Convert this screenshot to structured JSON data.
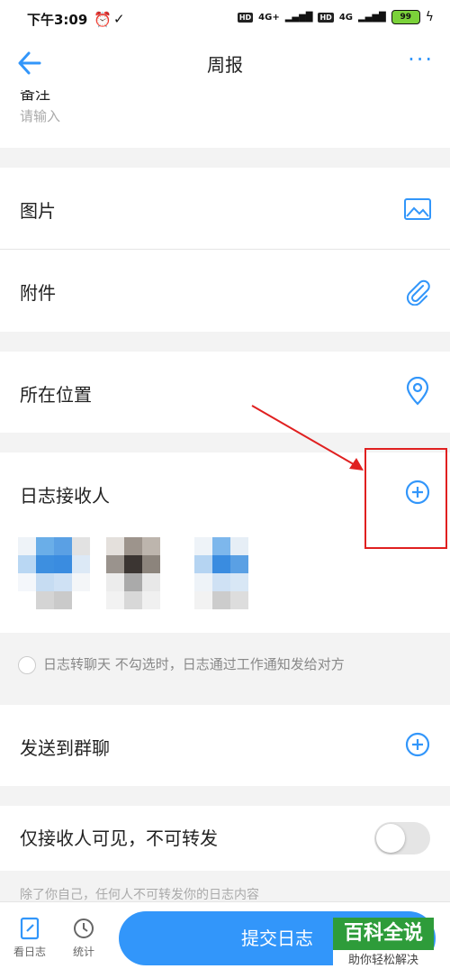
{
  "status": {
    "time": "下午3:09",
    "hd1": "HD",
    "net1": "4G+",
    "hd2": "HD",
    "net2": "4G",
    "battery": "99"
  },
  "nav": {
    "title": "周报",
    "more": "···"
  },
  "remark": {
    "label": "备注",
    "placeholder": "请输入"
  },
  "rows": {
    "image": "图片",
    "attachment": "附件",
    "location": "所在位置",
    "recipients": "日志接收人",
    "send_group": "发送到群聊",
    "visible_only": "仅接收人可见，不可转发"
  },
  "hint": {
    "chat_option": "日志转聊天 不勾选时，日志通过工作通知发给对方"
  },
  "footer_hint": "除了你自己，任何人不可转发你的日志内容",
  "bottom": {
    "tab_view": "看日志",
    "tab_stats": "统计",
    "submit": "提交日志"
  },
  "watermark": {
    "title": "百科全说",
    "subtitle": "助你轻松解决"
  },
  "colors": {
    "accent": "#3296fa",
    "annotation": "#e02020"
  }
}
